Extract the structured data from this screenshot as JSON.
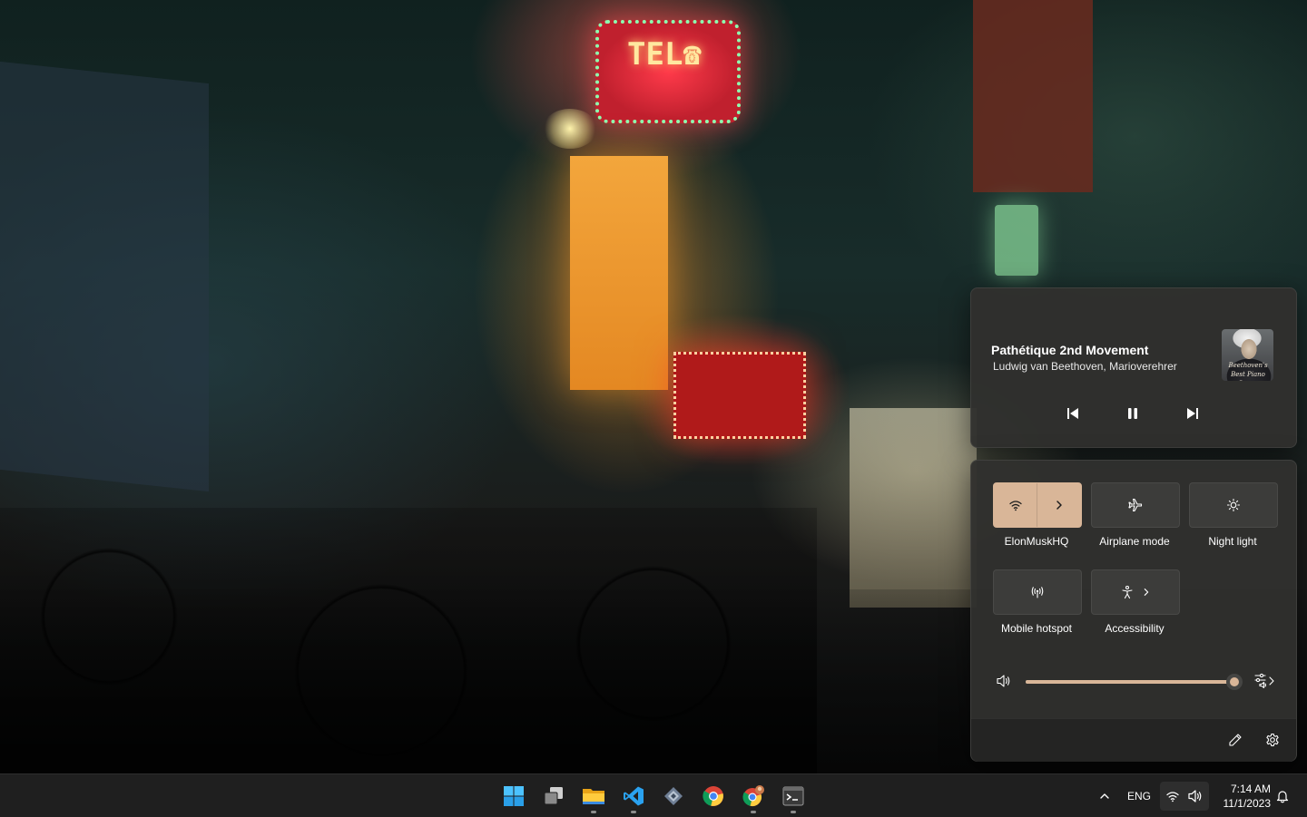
{
  "media": {
    "title": "Pathétique 2nd Movement",
    "artist": "Ludwig van Beethoven, Marioverehrer",
    "album_art_text": "Beethoven's Best Piano Songs",
    "controls": [
      "previous-track",
      "pause",
      "next-track"
    ]
  },
  "quick_settings": {
    "tiles": [
      {
        "label": "ElonMuskHQ",
        "icon": "wifi-icon",
        "active": true,
        "has_expand": true
      },
      {
        "label": "Airplane mode",
        "icon": "airplane-icon",
        "active": false
      },
      {
        "label": "Night light",
        "icon": "night-light-icon",
        "active": false
      },
      {
        "label": "Mobile hotspot",
        "icon": "hotspot-icon",
        "active": false
      },
      {
        "label": "Accessibility",
        "icon": "accessibility-icon",
        "active": false,
        "has_expand": true
      }
    ],
    "volume": {
      "level": 100,
      "icon": "speaker-icon",
      "mixer_icon": "audio-mixer-icon"
    },
    "footer": {
      "edit_icon": "pencil-icon",
      "settings_icon": "gear-icon"
    },
    "accent_color": "#d9b698"
  },
  "taskbar": {
    "apps": [
      {
        "name": "Start",
        "icon": "windows-start-icon"
      },
      {
        "name": "Task View",
        "icon": "task-view-icon"
      },
      {
        "name": "File Explorer",
        "icon": "folder-icon",
        "running": true
      },
      {
        "name": "Visual Studio Code",
        "icon": "vscode-icon",
        "running": true
      },
      {
        "name": "App",
        "icon": "diamond-app-icon"
      },
      {
        "name": "Google Chrome",
        "icon": "chrome-icon"
      },
      {
        "name": "Google Chrome Profile",
        "icon": "chrome-profile-icon",
        "running": true
      },
      {
        "name": "Terminal",
        "icon": "terminal-icon",
        "running": true
      }
    ],
    "tray": {
      "language": "ENG",
      "time": "7:14 AM",
      "date": "11/1/2023"
    }
  }
}
